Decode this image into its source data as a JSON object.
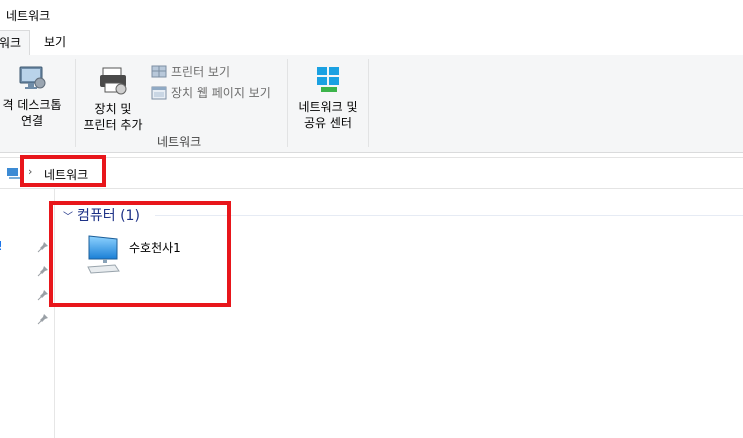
{
  "window": {
    "title": "네트워크"
  },
  "tabs": [
    {
      "label": "워크"
    },
    {
      "label": "보기"
    }
  ],
  "ribbon": {
    "remote_desktop_label": "격 데스크톱\n연결",
    "add_devices_label": "장치 및\n프린터 추가",
    "view_printers_label": "프린터 보기",
    "view_device_webpage_label": "장치 웹 페이지 보기",
    "network_group_label": "네트워크",
    "network_sharing_label": "네트워크 및\n공유 센터"
  },
  "address": {
    "crumb": "네트워크",
    "arrow": "›"
  },
  "nav": {
    "left_link": "!"
  },
  "content": {
    "group_title": "컴퓨터 (1)",
    "group_chevron": "﹀",
    "items": [
      {
        "label": "수호천사1"
      }
    ]
  },
  "colors": {
    "highlight": "#e8161b",
    "group_title": "#1e3287"
  }
}
